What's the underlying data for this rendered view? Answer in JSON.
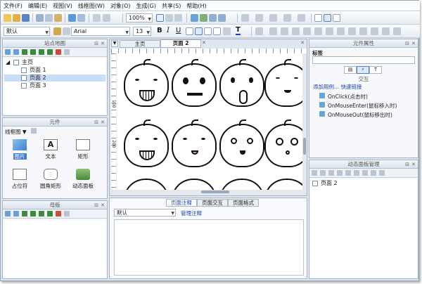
{
  "menu": [
    "文件(F)",
    "编辑(E)",
    "视图(V)",
    "线框图(W)",
    "对象(O)",
    "生成(G)",
    "共享(S)",
    "帮助(H)"
  ],
  "toolbar": {
    "zoom": "100%",
    "style": "默认",
    "font": "Arial",
    "size": "13",
    "bold": "B",
    "italic": "I",
    "underline": "U",
    "text_color": "T"
  },
  "sitemap": {
    "title": "站点地图",
    "root": "主页",
    "pages": [
      "页面 1",
      "页面 2",
      "页面 3"
    ],
    "selected_index": 1
  },
  "widgets": {
    "title": "元件",
    "library": "线框图",
    "items": [
      "图片",
      "文本",
      "矩形",
      "占位符",
      "圆角矩形",
      "动态面板"
    ]
  },
  "masters": {
    "title": "母版"
  },
  "canvas": {
    "tabs": [
      "主页",
      "页面 2"
    ],
    "active_tab": 1,
    "ruler_marks": [
      "100",
      "200"
    ]
  },
  "notes": {
    "tabs": [
      "页面注释",
      "页面交互",
      "页面格式"
    ],
    "active_tab": 0,
    "select_value": "默认",
    "manage_link": "管理注释"
  },
  "props": {
    "title": "元件属性",
    "label_heading": "标签",
    "section": "交互",
    "add_case": "添加用例",
    "quick_link": "快速链接",
    "events": [
      "OnClick(点击时)",
      "OnMouseEnter(鼠标移入时)",
      "OnMouseOut(鼠标移出时)"
    ]
  },
  "dpm": {
    "title": "动态面板管理",
    "page": "页面 2"
  },
  "colors": {
    "accent": "#3f7fd1",
    "selected_row": "#c9ddf6",
    "panel_bg": "#f6f8fb"
  }
}
